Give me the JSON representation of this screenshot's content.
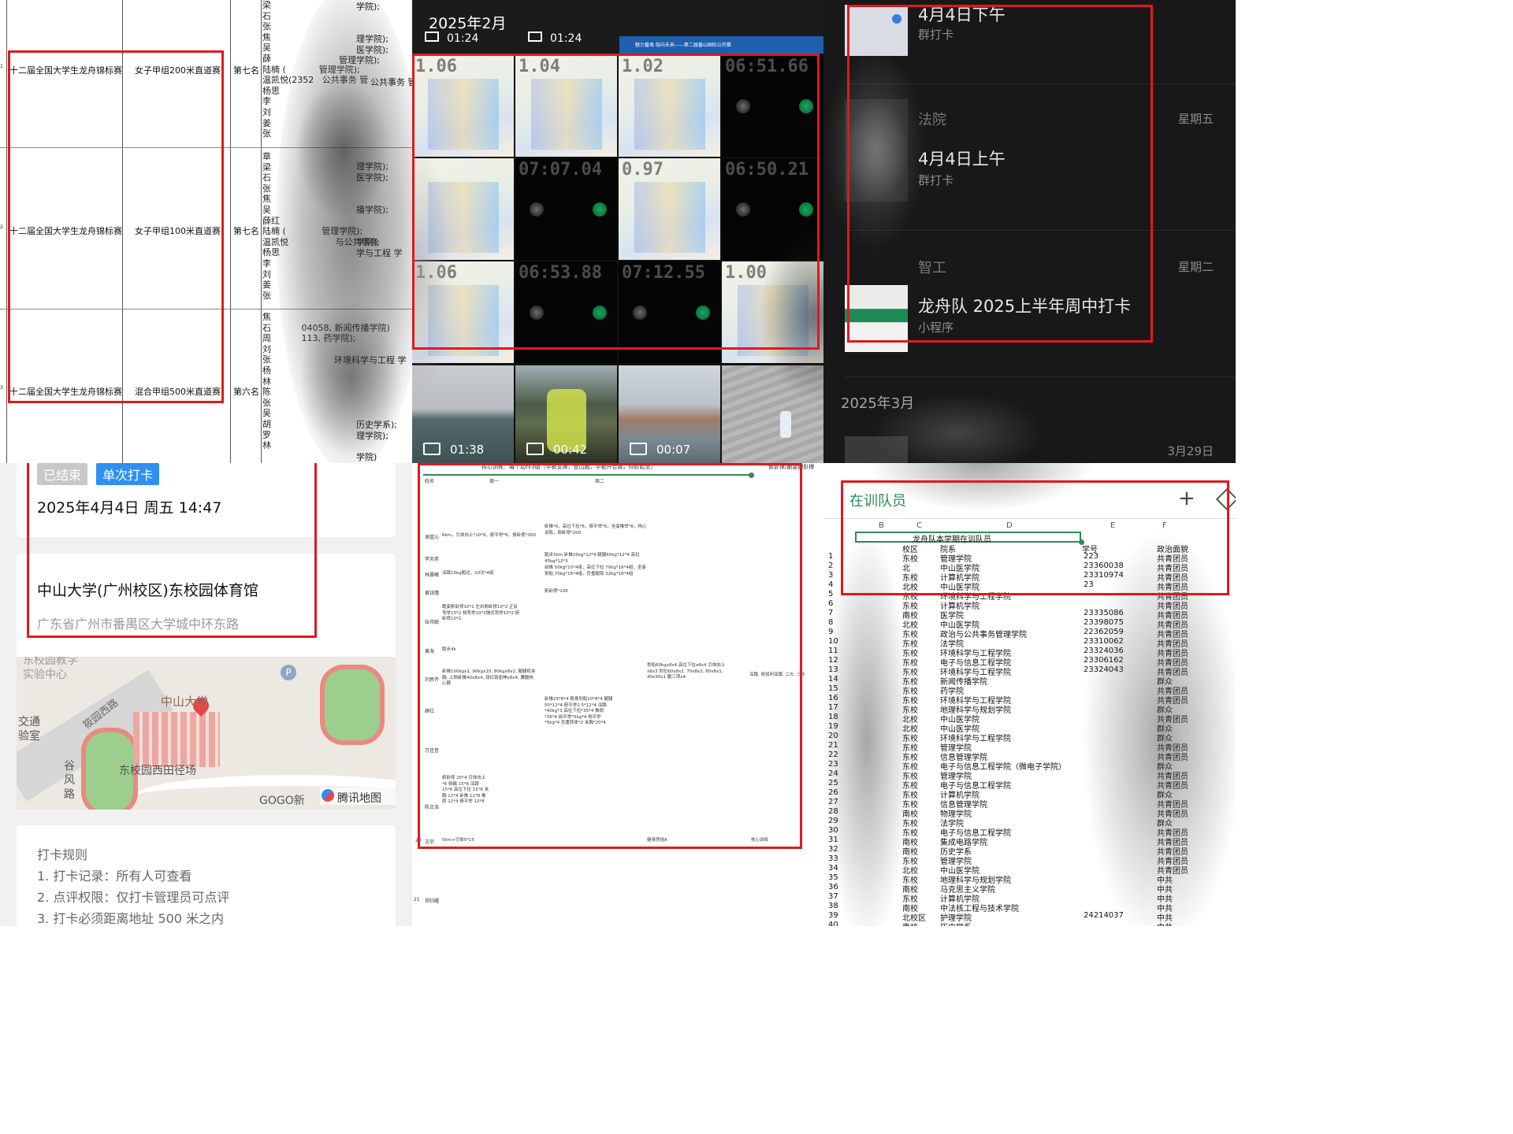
{
  "colors": {
    "annotation_red": "#e0191d",
    "tag_ended": "#c8c8c8",
    "tag_single": "#2f8ff2",
    "map_pin": "#e8474a",
    "sheet_green": "#2e8b57"
  },
  "awards": {
    "rows": [
      {
        "competition": "十二届全国大学生龙舟锦标赛",
        "event": "女子甲组200米直道赛",
        "rank": "第七名"
      },
      {
        "competition": "十二届全国大学生龙舟锦标赛",
        "event": "女子甲组100米直道赛",
        "rank": "第七名"
      },
      {
        "competition": "十二届全国大学生龙舟锦标赛",
        "event": "混合甲组500米直道赛",
        "rank": "第六名"
      }
    ],
    "row_numbers": [
      "1",
      "2",
      "3"
    ],
    "names_block_1": "梁\n石\n张\n焦\n吴\n薛\n陆楠 (            管理学院);\n温凯悦(2352   公共事务 管\n杨思\n李\n刘\n姜\n张",
    "names_block_2": "章\n梁\n石\n张\n焦\n吴\n薛红\n陆楠 (             管理学院);\n温凯悦                 与公共事务\n杨思\n李\n刘\n姜\n张",
    "names_block_3": "焦\n石           04058, 新闻传播学院)\n周           113, 药学院);\n刘\n张\n杨\n林\n陈\n张\n吴\n胡\n罗\n林",
    "names_fragments": [
      "学院);",
      "理学院);",
      "医学院);",
      "管理学院);",
      "公共事务 管",
      "理学院);",
      "医学院);",
      "播学院);",
      "学院);",
      "学与工程 学",
      "环境科学与工程 学",
      "历史学系);",
      "理学院);",
      "学院)"
    ]
  },
  "gallery": {
    "month": "2025年2月",
    "top_durations": [
      "01:24",
      "01:24"
    ],
    "banner": "魅力番禺 船向未来——第二届番山国际公开赛",
    "tiles": [
      {
        "big": "1.06",
        "kind": "light"
      },
      {
        "big": "1.04",
        "kind": "light"
      },
      {
        "big": "1.02",
        "kind": "light"
      },
      {
        "big": "06:51.66",
        "kind": "dark"
      },
      {
        "big": "",
        "kind": "light"
      },
      {
        "big": "07:07.04",
        "kind": "dark"
      },
      {
        "big": "0.97",
        "kind": "light"
      },
      {
        "big": "06:50.21",
        "kind": "dark"
      },
      {
        "big": "1.06",
        "kind": "light"
      },
      {
        "big": "06:53.88",
        "kind": "dark"
      },
      {
        "big": "07:12.55",
        "kind": "dark"
      },
      {
        "big": "1.00",
        "kind": "light"
      }
    ],
    "videos": [
      "01:38",
      "00:42",
      "00:07",
      ""
    ]
  },
  "chat": {
    "items": [
      {
        "title": "4月4日下午",
        "subtitle": "群打卡",
        "sender": "",
        "day": ""
      },
      {
        "title": "4月4日上午",
        "subtitle": "群打卡",
        "sender": "法院",
        "day": "星期五"
      },
      {
        "title": "龙舟队 2025上半年周中打卡",
        "subtitle": "小程序",
        "sender": "智工",
        "day": "星期二"
      }
    ],
    "section": "2025年3月",
    "last_day": "3月29日"
  },
  "checkin": {
    "tag_ended": "已结束",
    "tag_single": "单次打卡",
    "datetime": "2025年4月4日 周五 14:47",
    "venue": "中山大学(广州校区)东校园体育馆",
    "address": "广东省广州市番禺区大学城中环东路",
    "map": {
      "labels": [
        "东校园教学",
        "实验中心",
        "中山大学",
        "筱园西路",
        "交通",
        "验室",
        "谷",
        "风",
        "路",
        "东校园西田径场",
        "GOGO新",
        "腾讯地图"
      ]
    },
    "rules_title": "打卡规则",
    "rules": [
      "1. 打卡记录：所有人可查看",
      "2. 点评权限：仅打卡管理员可点评",
      "3. 打卡必须距离地址 500 米之内"
    ]
  },
  "plan": {
    "header": "核心训练：每个动作3组（平板支撑，登山跑，平板开合跳，仰卧起坐）",
    "header_right": "俯卧撑/跪姿俯卧撑",
    "col_labels": [
      "姓名",
      "周一",
      "周二"
    ],
    "names": [
      "谢蓝沁",
      "李天奕",
      "林晨曦",
      "黄钰瑾",
      "伍伟聪",
      "黄海",
      "刘思齐",
      "薛红",
      "万佳音",
      "陈正浩",
      "古宇",
      "郑钧耀"
    ],
    "row_numbers": [
      "19",
      "20",
      "21"
    ],
    "lines": [
      "6km，引体向上*10*6，俯平举*6，俯卧撑*300",
      "卧推*6，高位下拉*6，俯平举*6，坐姿推举*6，核心训练，俯卧撑*200",
      "跑步5km  卧推25kg*12*4  腿腿65kg*12*4  高拉45kg*12*3",
      "前推 50kg*10*4组，高位下拉 70kg*16*4组，坐姿划船 70kg*16*4组，负重腿臂 32kg*16*4组",
      "深蹲15kg粗边，10次*4组",
      "俯卧撑*100",
      "跪姿俯卧撑10*2  左右俯卧撑10*2  正反弯举10*2  侧弯举10*2锤式弯举10*2  俯卧撑10*2",
      "跑步4k",
      "卧推100kgx1, 90kgx10, 80kgx8x2, 腿腿机夹胸, 上斜卧推40x8x4, 双杠臂屈伸x8x4, 腰腹核心器",
      "划船60kgx8x4  高位下拉x8x4  引体向上x6x3  肘拉60x8x2, 70x8x2, 80x8x1, 40x30x1  腹三项x4",
      "深蹲, 俯加利亚蹲, 二头, 三头",
      "卧推25*8*4  俯身划船10*8*4  腿腿55*12*4  俯平举2.5*12*4  深蹲*40kg*3  高位下拉*35*4  推肩*35*4  前平举*5kg*4  侧平举*5kg*4  负重转体*2  夹胸*20*4",
      "俯卧撑 25*4  引体向上*6  侧踢 15*6  深蹲 15*6  高位下拉 15*6  夹胸 12*4  卧推 12*8  推肩 12*4  俯平举 12*8",
      "5km+引体5*15",
      "健身房组A",
      "核心训练"
    ]
  },
  "sheet": {
    "tab": "在训队员",
    "title": "龙舟队本学期在训队员",
    "columns": [
      "B",
      "C",
      "D",
      "E",
      "F"
    ],
    "headers": [
      "校区",
      "院系",
      "学号",
      "政治面貌"
    ],
    "rows": [
      [
        "1",
        "东校",
        "管理学院",
        "223",
        "共青团员"
      ],
      [
        "2",
        "北",
        "中山医学院",
        "23360038",
        "共青团员"
      ],
      [
        "3",
        "东校",
        "计算机学院",
        "23310974",
        "共青团员"
      ],
      [
        "4",
        "北校",
        "中山医学院",
        "23",
        "共青团员"
      ],
      [
        "5",
        "东校",
        "环境科学与工程学院",
        "",
        "共青团员"
      ],
      [
        "6",
        "东校",
        "计算机学院",
        "",
        "共青团员"
      ],
      [
        "7",
        "南校",
        "医学院",
        "23335086",
        "共青团员"
      ],
      [
        "8",
        "北校",
        "中山医学院",
        "23398075",
        "共青团员"
      ],
      [
        "9",
        "东校",
        "政治与公共事务管理学院",
        "22362059",
        "共青团员"
      ],
      [
        "10",
        "东校",
        "法学院",
        "23310062",
        "共青团员"
      ],
      [
        "11",
        "东校",
        "环境科学与工程学院",
        "23324036",
        "共青团员"
      ],
      [
        "12",
        "东校",
        "电子与信息工程学院",
        "23306162",
        "共青团员"
      ],
      [
        "13",
        "东校",
        "环境科学与工程学院",
        "23324043",
        "共青团员"
      ],
      [
        "14",
        "东校",
        "新闻传播学院",
        "",
        "群众"
      ],
      [
        "15",
        "东校",
        "药学院",
        "",
        "共青团员"
      ],
      [
        "16",
        "东校",
        "环境科学与工程学院",
        "",
        "共青团员"
      ],
      [
        "17",
        "东校",
        "地理科学与规划学院",
        "",
        "群众"
      ],
      [
        "18",
        "北校",
        "中山医学院",
        "",
        "共青团员"
      ],
      [
        "19",
        "北校",
        "中山医学院",
        "",
        "群众"
      ],
      [
        "20",
        "东校",
        "环境科学与工程学院",
        "",
        "群众"
      ],
      [
        "21",
        "东校",
        "管理学院",
        "",
        "共青团员"
      ],
      [
        "22",
        "东校",
        "信息管理学院",
        "",
        "共青团员"
      ],
      [
        "23",
        "东校",
        "电子与信息工程学院（微电子学院）",
        "",
        "群众"
      ],
      [
        "24",
        "东校",
        "管理学院",
        "",
        "共青团员"
      ],
      [
        "25",
        "东校",
        "电子与信息工程学院",
        "",
        "共青团员"
      ],
      [
        "26",
        "东校",
        "计算机学院",
        "",
        "群众"
      ],
      [
        "27",
        "东校",
        "信息管理学院",
        "",
        "共青团员"
      ],
      [
        "28",
        "南校",
        "物理学院",
        "",
        "共青团员"
      ],
      [
        "29",
        "东校",
        "法学院",
        "",
        "群众"
      ],
      [
        "30",
        "东校",
        "电子与信息工程学院",
        "",
        "共青团员"
      ],
      [
        "31",
        "南校",
        "集成电路学院",
        "",
        "共青团员"
      ],
      [
        "32",
        "南校",
        "历史学系",
        "",
        "共青团员"
      ],
      [
        "33",
        "东校",
        "管理学院",
        "",
        "共青团员"
      ],
      [
        "34",
        "北校",
        "中山医学院",
        "",
        "共青团员"
      ],
      [
        "35",
        "东校",
        "地理科学与规划学院",
        "",
        "中共"
      ],
      [
        "36",
        "南校",
        "马克思主义学院",
        "",
        "中共"
      ],
      [
        "37",
        "东校",
        "计算机学院",
        "",
        "中共"
      ],
      [
        "38",
        "南校",
        "中法核工程与技术学院",
        "",
        "中共"
      ],
      [
        "39",
        "北校区",
        "护理学院",
        "24214037",
        "中共"
      ],
      [
        "40",
        "南校",
        "历史学系",
        "",
        "中共"
      ]
    ]
  }
}
